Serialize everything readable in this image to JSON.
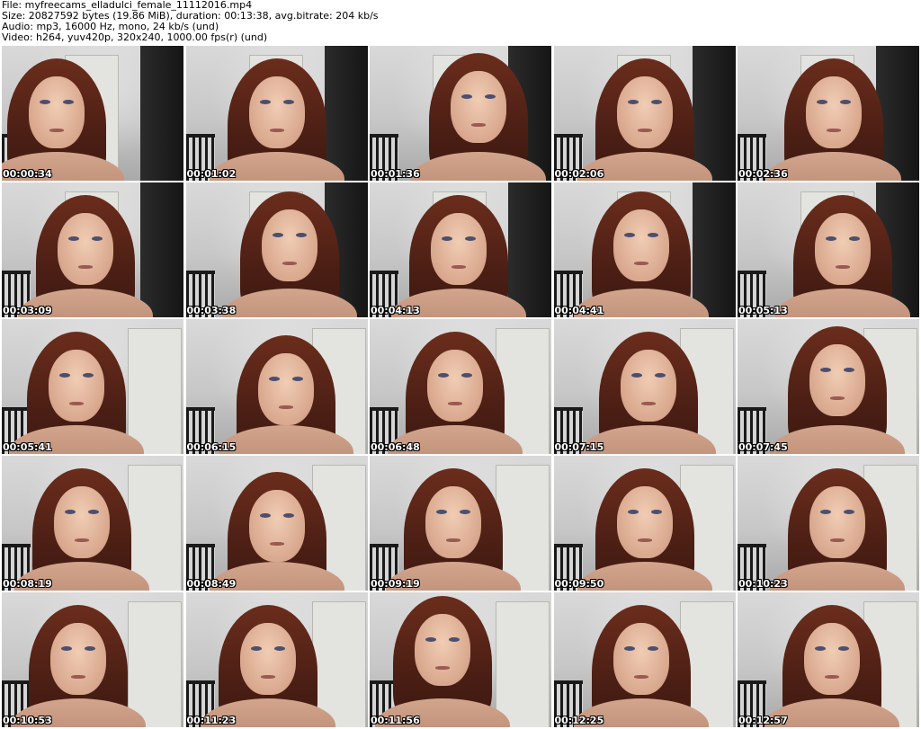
{
  "header": {
    "file_line": "File: myfreecams_elladulci_female_11112016.mp4",
    "size_line": "Size: 20827592 bytes (19.86 MiB), duration: 00:13:38, avg.bitrate: 204 kb/s",
    "audio_line": "Audio: mp3, 16000 Hz, mono, 24 kb/s (und)",
    "video_line": "Video: h264, yuv420p, 320x240, 1000.00 fps(r) (und)"
  },
  "thumbnails": [
    {
      "timestamp": "00:00:34"
    },
    {
      "timestamp": "00:01:02"
    },
    {
      "timestamp": "00:01:36"
    },
    {
      "timestamp": "00:02:06"
    },
    {
      "timestamp": "00:02:36"
    },
    {
      "timestamp": "00:03:09"
    },
    {
      "timestamp": "00:03:38"
    },
    {
      "timestamp": "00:04:13"
    },
    {
      "timestamp": "00:04:41"
    },
    {
      "timestamp": "00:05:13"
    },
    {
      "timestamp": "00:05:41"
    },
    {
      "timestamp": "00:06:15"
    },
    {
      "timestamp": "00:06:48"
    },
    {
      "timestamp": "00:07:15"
    },
    {
      "timestamp": "00:07:45"
    },
    {
      "timestamp": "00:08:19"
    },
    {
      "timestamp": "00:08:49"
    },
    {
      "timestamp": "00:09:19"
    },
    {
      "timestamp": "00:09:50"
    },
    {
      "timestamp": "00:10:23"
    },
    {
      "timestamp": "00:10:53"
    },
    {
      "timestamp": "00:11:23"
    },
    {
      "timestamp": "00:11:56"
    },
    {
      "timestamp": "00:12:25"
    },
    {
      "timestamp": "00:12:57"
    }
  ]
}
